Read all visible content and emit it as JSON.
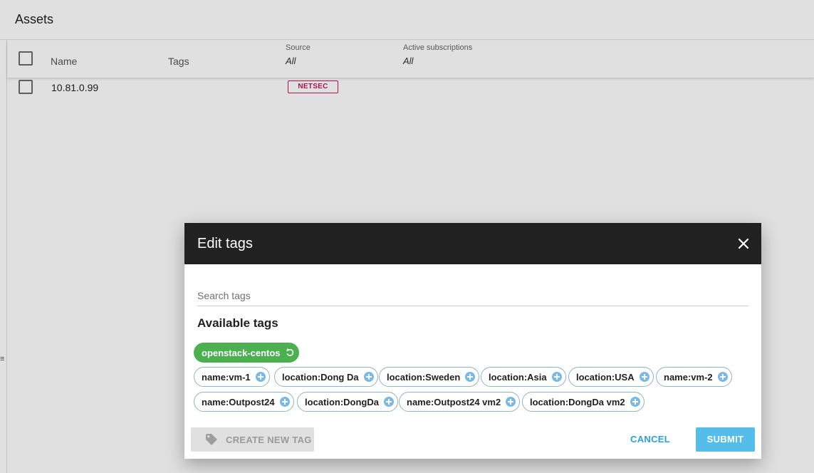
{
  "page": {
    "title": "Assets",
    "columns": {
      "name": "Name",
      "tags": "Tags",
      "source_label": "Source",
      "source_value": "All",
      "subscriptions_label": "Active subscriptions",
      "subscriptions_value": "All"
    },
    "rows": [
      {
        "name": "10.81.0.99",
        "source": "NETSEC"
      }
    ]
  },
  "dialog": {
    "title": "Edit tags",
    "search_placeholder": "Search tags",
    "section_title": "Available tags",
    "selected_tags": [
      "openstack-centos"
    ],
    "available_tags": [
      "name:vm-1",
      "location:Dong Da",
      "location:Sweden",
      "location:Asia",
      "location:USA",
      "name:vm-2",
      "name:Outpost24",
      "location:DongDa",
      "name:Outpost24 vm2",
      "location:DongDa vm2"
    ],
    "create_label": "CREATE NEW TAG",
    "cancel_label": "CANCEL",
    "submit_label": "SUBMIT"
  },
  "colors": {
    "dialog_header": "#212121",
    "selected_chip": "#4caf50",
    "chip_border": "#8fb3c9",
    "plus_icon": "#7ab8e8",
    "submit": "#55bde9",
    "cancel": "#29a2d9",
    "source_badge": "#c2185b"
  }
}
